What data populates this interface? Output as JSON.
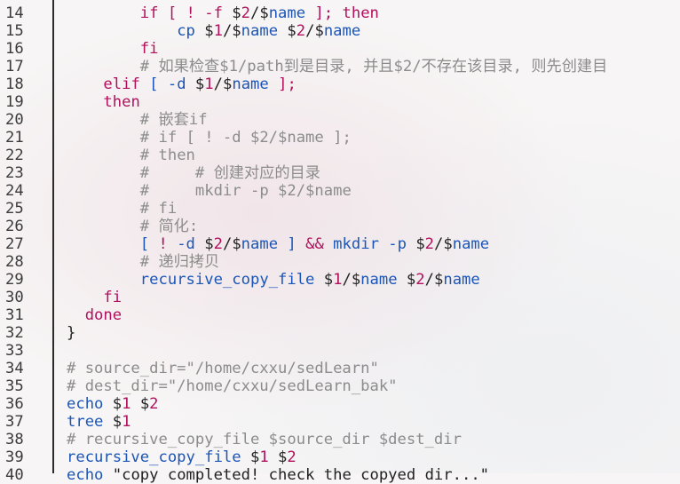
{
  "editor": {
    "lines": [
      {
        "n": "14",
        "tokens": [
          {
            "t": "        ",
            "c": "tx"
          },
          {
            "t": "if [ ! -f",
            "c": "kw"
          },
          {
            "t": " $",
            "c": "tx"
          },
          {
            "t": "2",
            "c": "kw"
          },
          {
            "t": "/$",
            "c": "tx"
          },
          {
            "t": "name",
            "c": "bi"
          },
          {
            "t": " ]; then",
            "c": "kw"
          }
        ]
      },
      {
        "n": "15",
        "tokens": [
          {
            "t": "            ",
            "c": "tx"
          },
          {
            "t": "cp",
            "c": "bi"
          },
          {
            "t": " $",
            "c": "tx"
          },
          {
            "t": "1",
            "c": "kw"
          },
          {
            "t": "/$",
            "c": "tx"
          },
          {
            "t": "name",
            "c": "bi"
          },
          {
            "t": " $",
            "c": "tx"
          },
          {
            "t": "2",
            "c": "kw"
          },
          {
            "t": "/$",
            "c": "tx"
          },
          {
            "t": "name",
            "c": "bi"
          }
        ]
      },
      {
        "n": "16",
        "tokens": [
          {
            "t": "        ",
            "c": "tx"
          },
          {
            "t": "fi",
            "c": "kw"
          }
        ]
      },
      {
        "n": "17",
        "tokens": [
          {
            "t": "        ",
            "c": "tx"
          },
          {
            "t": "# 如果检查$1/path到是目录, 并且$2/不存在该目录, 则先创建目",
            "c": "cm"
          }
        ]
      },
      {
        "n": "18",
        "tokens": [
          {
            "t": "    ",
            "c": "tx"
          },
          {
            "t": "elif",
            "c": "kw"
          },
          {
            "t": " ",
            "c": "tx"
          },
          {
            "t": "[ -d",
            "c": "bi"
          },
          {
            "t": " $",
            "c": "tx"
          },
          {
            "t": "1",
            "c": "kw"
          },
          {
            "t": "/$",
            "c": "tx"
          },
          {
            "t": "name",
            "c": "bi"
          },
          {
            "t": " ];",
            "c": "kw"
          }
        ]
      },
      {
        "n": "19",
        "tokens": [
          {
            "t": "    ",
            "c": "tx"
          },
          {
            "t": "then",
            "c": "kw"
          }
        ]
      },
      {
        "n": "20",
        "tokens": [
          {
            "t": "        ",
            "c": "tx"
          },
          {
            "t": "# 嵌套if",
            "c": "cm"
          }
        ]
      },
      {
        "n": "21",
        "tokens": [
          {
            "t": "        ",
            "c": "tx"
          },
          {
            "t": "# if [ ! -d $2/$name ];",
            "c": "cm"
          }
        ]
      },
      {
        "n": "22",
        "tokens": [
          {
            "t": "        ",
            "c": "tx"
          },
          {
            "t": "# then",
            "c": "cm"
          }
        ]
      },
      {
        "n": "23",
        "tokens": [
          {
            "t": "        ",
            "c": "tx"
          },
          {
            "t": "#     # 创建对应的目录",
            "c": "cm"
          }
        ]
      },
      {
        "n": "24",
        "tokens": [
          {
            "t": "        ",
            "c": "tx"
          },
          {
            "t": "#     mkdir -p $2/$name",
            "c": "cm"
          }
        ]
      },
      {
        "n": "25",
        "tokens": [
          {
            "t": "        ",
            "c": "tx"
          },
          {
            "t": "# fi",
            "c": "cm"
          }
        ]
      },
      {
        "n": "26",
        "tokens": [
          {
            "t": "        ",
            "c": "tx"
          },
          {
            "t": "# 简化:",
            "c": "cm"
          }
        ]
      },
      {
        "n": "27",
        "tokens": [
          {
            "t": "        ",
            "c": "tx"
          },
          {
            "t": "[ ",
            "c": "bi"
          },
          {
            "t": "!",
            "c": "kw"
          },
          {
            "t": " -d",
            "c": "bi"
          },
          {
            "t": " $",
            "c": "tx"
          },
          {
            "t": "2",
            "c": "kw"
          },
          {
            "t": "/$",
            "c": "tx"
          },
          {
            "t": "name",
            "c": "bi"
          },
          {
            "t": " ] ",
            "c": "bi"
          },
          {
            "t": "&&",
            "c": "kw"
          },
          {
            "t": " mkdir -p",
            "c": "bi"
          },
          {
            "t": " $",
            "c": "tx"
          },
          {
            "t": "2",
            "c": "kw"
          },
          {
            "t": "/$",
            "c": "tx"
          },
          {
            "t": "name",
            "c": "bi"
          }
        ]
      },
      {
        "n": "28",
        "tokens": [
          {
            "t": "        ",
            "c": "tx"
          },
          {
            "t": "# 递归拷贝",
            "c": "cm"
          }
        ]
      },
      {
        "n": "29",
        "tokens": [
          {
            "t": "        ",
            "c": "tx"
          },
          {
            "t": "recursive_copy_file",
            "c": "bi"
          },
          {
            "t": " $",
            "c": "tx"
          },
          {
            "t": "1",
            "c": "kw"
          },
          {
            "t": "/$",
            "c": "tx"
          },
          {
            "t": "name",
            "c": "bi"
          },
          {
            "t": " $",
            "c": "tx"
          },
          {
            "t": "2",
            "c": "kw"
          },
          {
            "t": "/$",
            "c": "tx"
          },
          {
            "t": "name",
            "c": "bi"
          }
        ]
      },
      {
        "n": "30",
        "tokens": [
          {
            "t": "    ",
            "c": "tx"
          },
          {
            "t": "fi",
            "c": "kw"
          }
        ]
      },
      {
        "n": "31",
        "tokens": [
          {
            "t": "  ",
            "c": "tx"
          },
          {
            "t": "done",
            "c": "kw"
          }
        ]
      },
      {
        "n": "32",
        "tokens": [
          {
            "t": "}",
            "c": "tx"
          }
        ]
      },
      {
        "n": "33",
        "tokens": []
      },
      {
        "n": "34",
        "tokens": [
          {
            "t": "# source_dir=\"/home/cxxu/sedLearn\"",
            "c": "cm"
          }
        ]
      },
      {
        "n": "35",
        "tokens": [
          {
            "t": "# dest_dir=\"/home/cxxu/sedLearn_bak\"",
            "c": "cm"
          }
        ]
      },
      {
        "n": "36",
        "tokens": [
          {
            "t": "echo",
            "c": "bi"
          },
          {
            "t": " $",
            "c": "tx"
          },
          {
            "t": "1",
            "c": "kw"
          },
          {
            "t": " $",
            "c": "tx"
          },
          {
            "t": "2",
            "c": "kw"
          }
        ]
      },
      {
        "n": "37",
        "tokens": [
          {
            "t": "tree",
            "c": "bi"
          },
          {
            "t": " $",
            "c": "tx"
          },
          {
            "t": "1",
            "c": "kw"
          }
        ]
      },
      {
        "n": "38",
        "tokens": [
          {
            "t": "# recursive_copy_file $source_dir $dest_dir",
            "c": "cm"
          }
        ]
      },
      {
        "n": "39",
        "tokens": [
          {
            "t": "recursive_copy_file",
            "c": "bi"
          },
          {
            "t": " $",
            "c": "tx"
          },
          {
            "t": "1",
            "c": "kw"
          },
          {
            "t": " $",
            "c": "tx"
          },
          {
            "t": "2",
            "c": "kw"
          }
        ]
      },
      {
        "n": "40",
        "tokens": [
          {
            "t": "echo",
            "c": "bi"
          },
          {
            "t": " \"copy completed! check the copyed dir...\"",
            "c": "tx"
          }
        ]
      }
    ]
  }
}
